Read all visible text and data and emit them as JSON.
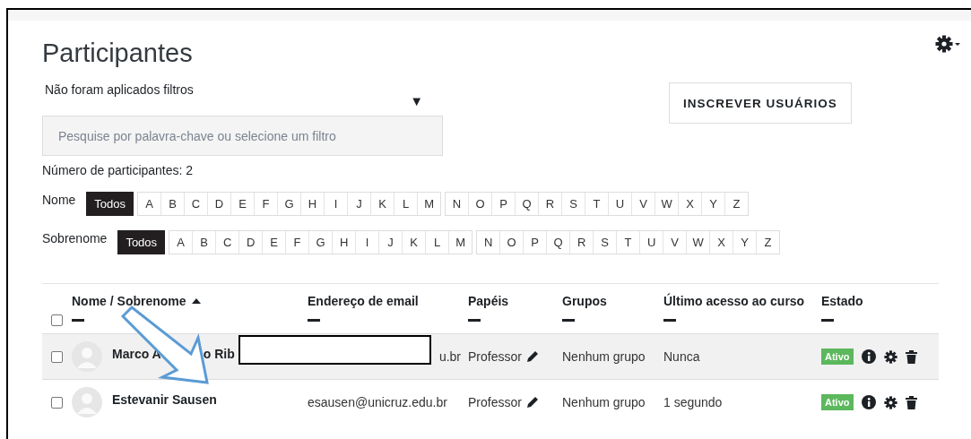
{
  "header": {
    "title": "Participantes"
  },
  "filter": {
    "summary": "Não foram aplicados filtros",
    "toggle": "▼",
    "search": {
      "placeholder": "Pesquise por palavra-chave ou selecione um filtro"
    }
  },
  "enrol_button": "INSCREVER USUÁRIOS",
  "count": "Número de participantes: 2",
  "initials_bars": [
    {
      "label": "Nome",
      "all": {
        "label": "Todos",
        "selected": true
      },
      "groups": [
        [
          {
            "label": "A",
            "selected": false
          },
          {
            "label": "B",
            "selected": false
          },
          {
            "label": "C",
            "selected": false
          },
          {
            "label": "D",
            "selected": false
          },
          {
            "label": "E",
            "selected": false
          },
          {
            "label": "F",
            "selected": false
          },
          {
            "label": "G",
            "selected": false
          },
          {
            "label": "H",
            "selected": false
          },
          {
            "label": "I",
            "selected": false
          },
          {
            "label": "J",
            "selected": false
          },
          {
            "label": "K",
            "selected": false
          },
          {
            "label": "L",
            "selected": false
          },
          {
            "label": "M",
            "selected": false
          }
        ],
        [
          {
            "label": "N",
            "selected": false
          },
          {
            "label": "O",
            "selected": false
          },
          {
            "label": "P",
            "selected": false
          },
          {
            "label": "Q",
            "selected": false
          },
          {
            "label": "R",
            "selected": false
          },
          {
            "label": "S",
            "selected": false
          },
          {
            "label": "T",
            "selected": false
          },
          {
            "label": "U",
            "selected": false
          },
          {
            "label": "V",
            "selected": false
          },
          {
            "label": "W",
            "selected": false
          },
          {
            "label": "X",
            "selected": false
          },
          {
            "label": "Y",
            "selected": false
          },
          {
            "label": "Z",
            "selected": false
          }
        ]
      ]
    },
    {
      "label": "Sobrenome",
      "all": {
        "label": "Todos",
        "selected": true
      },
      "groups": [
        [
          {
            "label": "A",
            "selected": false
          },
          {
            "label": "B",
            "selected": false
          },
          {
            "label": "C",
            "selected": false
          },
          {
            "label": "D",
            "selected": false
          },
          {
            "label": "E",
            "selected": false
          },
          {
            "label": "F",
            "selected": false
          },
          {
            "label": "G",
            "selected": false
          },
          {
            "label": "H",
            "selected": false
          },
          {
            "label": "I",
            "selected": false
          },
          {
            "label": "J",
            "selected": false
          },
          {
            "label": "K",
            "selected": false
          },
          {
            "label": "L",
            "selected": false
          },
          {
            "label": "M",
            "selected": false
          }
        ],
        [
          {
            "label": "N",
            "selected": false
          },
          {
            "label": "O",
            "selected": false
          },
          {
            "label": "P",
            "selected": false
          },
          {
            "label": "Q",
            "selected": false
          },
          {
            "label": "R",
            "selected": false
          },
          {
            "label": "S",
            "selected": false
          },
          {
            "label": "T",
            "selected": false
          },
          {
            "label": "U",
            "selected": false
          },
          {
            "label": "V",
            "selected": false
          },
          {
            "label": "W",
            "selected": false
          },
          {
            "label": "X",
            "selected": false
          },
          {
            "label": "Y",
            "selected": false
          },
          {
            "label": "Z",
            "selected": false
          }
        ]
      ]
    }
  ],
  "table": {
    "select_all": {
      "checked": false
    },
    "columns": [
      {
        "label": "Nome / Sobrenome",
        "sorted_ascending": true
      },
      {
        "label": "Endereço de email",
        "sorted_ascending": false
      },
      {
        "label": "Papéis",
        "sorted_ascending": false
      },
      {
        "label": "Grupos",
        "sorted_ascending": false
      },
      {
        "label": "Último acesso ao curso",
        "sorted_ascending": false
      },
      {
        "label": "Estado",
        "sorted_ascending": false
      }
    ],
    "rows": [
      {
        "checked": false,
        "name_parts": [
          "Marco A",
          "o Rib"
        ],
        "email": "u.br",
        "role": "Professor",
        "groups": "Nenhum grupo",
        "last_access": "Nunca",
        "status": "Ativo",
        "redacted": true
      },
      {
        "checked": false,
        "name_parts": [
          "Estevanir Sausen"
        ],
        "email": "esausen@unicruz.edu.br",
        "role": "Professor",
        "groups": "Nenhum grupo",
        "last_access": "1 segundo",
        "status": "Ativo",
        "redacted": false
      }
    ]
  }
}
